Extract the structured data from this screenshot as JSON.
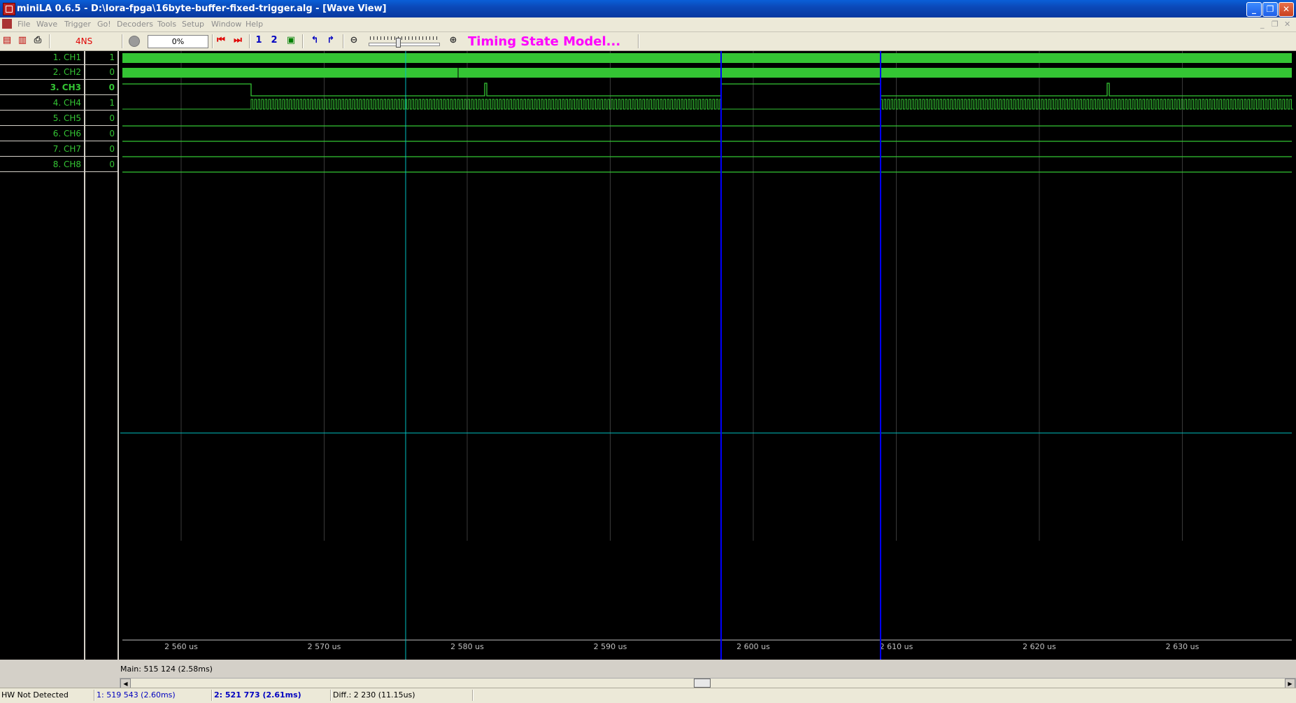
{
  "window": {
    "title": "miniLA 0.6.5 - D:\\lora-fpga\\16byte-buffer-fixed-trigger.alg - [Wave View]"
  },
  "menu": [
    "File",
    "Wave",
    "Trigger",
    "Go!",
    "Decoders",
    "Tools",
    "Setup",
    "Window",
    "Help"
  ],
  "toolbar": {
    "clock": "4NS",
    "progress": "0%",
    "mode_title": "Timing State Model..."
  },
  "channels": [
    {
      "name": "1. CH1",
      "value": "1"
    },
    {
      "name": "2. CH2",
      "value": "0"
    },
    {
      "name": "3. CH3",
      "value": "0"
    },
    {
      "name": "4. CH4",
      "value": "1"
    },
    {
      "name": "5. CH5",
      "value": "0"
    },
    {
      "name": "6. CH6",
      "value": "0"
    },
    {
      "name": "7. CH7",
      "value": "0"
    },
    {
      "name": "8. CH8",
      "value": "0"
    }
  ],
  "time_axis": {
    "unit": "us",
    "ticks": [
      "2 560 us",
      "2 570 us",
      "2 580 us",
      "2 590 us",
      "2 600 us",
      "2 610 us",
      "2 620 us",
      "2 630 us"
    ],
    "tick_values_us": [
      2560,
      2570,
      2580,
      2590,
      2600,
      2610,
      2620,
      2630
    ]
  },
  "markers": {
    "main": "Main: 515 124  (2.58ms)",
    "cursor1": "1: 519 543  (2.60ms)",
    "cursor2": "2: 521 773  (2.61ms)",
    "diff": "Diff.: 2 230  (11.15us)"
  },
  "status": {
    "hw": "HW Not Detected"
  },
  "colors": {
    "signal": "#34c534",
    "main_marker": "#00c0c0",
    "cursor": "#0000ff",
    "mode_title": "#ff00ff",
    "clock": "#e00000"
  }
}
